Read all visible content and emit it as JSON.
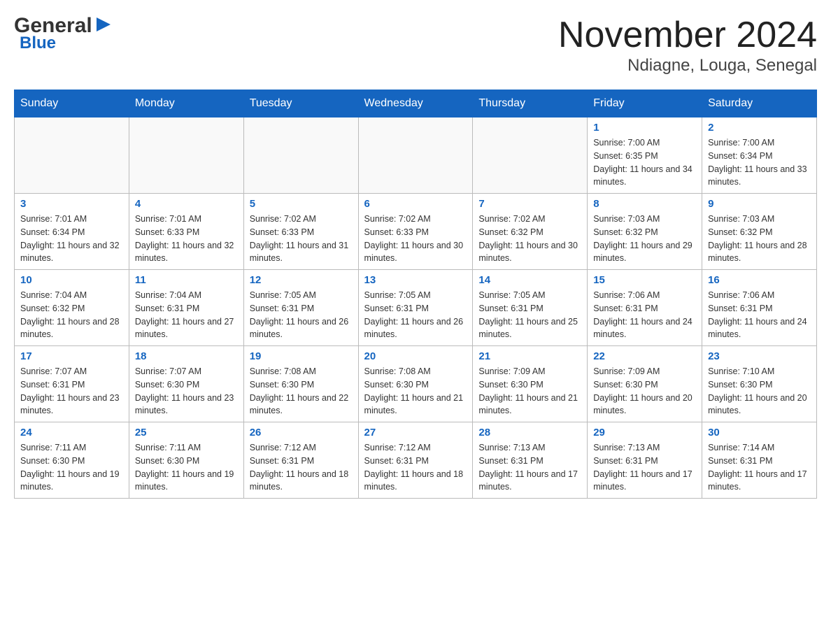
{
  "logo": {
    "general": "General",
    "arrow": "▶",
    "blue": "Blue"
  },
  "title": "November 2024",
  "subtitle": "Ndiagne, Louga, Senegal",
  "days": [
    "Sunday",
    "Monday",
    "Tuesday",
    "Wednesday",
    "Thursday",
    "Friday",
    "Saturday"
  ],
  "weeks": [
    [
      {
        "day": "",
        "info": ""
      },
      {
        "day": "",
        "info": ""
      },
      {
        "day": "",
        "info": ""
      },
      {
        "day": "",
        "info": ""
      },
      {
        "day": "",
        "info": ""
      },
      {
        "day": "1",
        "info": "Sunrise: 7:00 AM\nSunset: 6:35 PM\nDaylight: 11 hours and 34 minutes."
      },
      {
        "day": "2",
        "info": "Sunrise: 7:00 AM\nSunset: 6:34 PM\nDaylight: 11 hours and 33 minutes."
      }
    ],
    [
      {
        "day": "3",
        "info": "Sunrise: 7:01 AM\nSunset: 6:34 PM\nDaylight: 11 hours and 32 minutes."
      },
      {
        "day": "4",
        "info": "Sunrise: 7:01 AM\nSunset: 6:33 PM\nDaylight: 11 hours and 32 minutes."
      },
      {
        "day": "5",
        "info": "Sunrise: 7:02 AM\nSunset: 6:33 PM\nDaylight: 11 hours and 31 minutes."
      },
      {
        "day": "6",
        "info": "Sunrise: 7:02 AM\nSunset: 6:33 PM\nDaylight: 11 hours and 30 minutes."
      },
      {
        "day": "7",
        "info": "Sunrise: 7:02 AM\nSunset: 6:32 PM\nDaylight: 11 hours and 30 minutes."
      },
      {
        "day": "8",
        "info": "Sunrise: 7:03 AM\nSunset: 6:32 PM\nDaylight: 11 hours and 29 minutes."
      },
      {
        "day": "9",
        "info": "Sunrise: 7:03 AM\nSunset: 6:32 PM\nDaylight: 11 hours and 28 minutes."
      }
    ],
    [
      {
        "day": "10",
        "info": "Sunrise: 7:04 AM\nSunset: 6:32 PM\nDaylight: 11 hours and 28 minutes."
      },
      {
        "day": "11",
        "info": "Sunrise: 7:04 AM\nSunset: 6:31 PM\nDaylight: 11 hours and 27 minutes."
      },
      {
        "day": "12",
        "info": "Sunrise: 7:05 AM\nSunset: 6:31 PM\nDaylight: 11 hours and 26 minutes."
      },
      {
        "day": "13",
        "info": "Sunrise: 7:05 AM\nSunset: 6:31 PM\nDaylight: 11 hours and 26 minutes."
      },
      {
        "day": "14",
        "info": "Sunrise: 7:05 AM\nSunset: 6:31 PM\nDaylight: 11 hours and 25 minutes."
      },
      {
        "day": "15",
        "info": "Sunrise: 7:06 AM\nSunset: 6:31 PM\nDaylight: 11 hours and 24 minutes."
      },
      {
        "day": "16",
        "info": "Sunrise: 7:06 AM\nSunset: 6:31 PM\nDaylight: 11 hours and 24 minutes."
      }
    ],
    [
      {
        "day": "17",
        "info": "Sunrise: 7:07 AM\nSunset: 6:31 PM\nDaylight: 11 hours and 23 minutes."
      },
      {
        "day": "18",
        "info": "Sunrise: 7:07 AM\nSunset: 6:30 PM\nDaylight: 11 hours and 23 minutes."
      },
      {
        "day": "19",
        "info": "Sunrise: 7:08 AM\nSunset: 6:30 PM\nDaylight: 11 hours and 22 minutes."
      },
      {
        "day": "20",
        "info": "Sunrise: 7:08 AM\nSunset: 6:30 PM\nDaylight: 11 hours and 21 minutes."
      },
      {
        "day": "21",
        "info": "Sunrise: 7:09 AM\nSunset: 6:30 PM\nDaylight: 11 hours and 21 minutes."
      },
      {
        "day": "22",
        "info": "Sunrise: 7:09 AM\nSunset: 6:30 PM\nDaylight: 11 hours and 20 minutes."
      },
      {
        "day": "23",
        "info": "Sunrise: 7:10 AM\nSunset: 6:30 PM\nDaylight: 11 hours and 20 minutes."
      }
    ],
    [
      {
        "day": "24",
        "info": "Sunrise: 7:11 AM\nSunset: 6:30 PM\nDaylight: 11 hours and 19 minutes."
      },
      {
        "day": "25",
        "info": "Sunrise: 7:11 AM\nSunset: 6:30 PM\nDaylight: 11 hours and 19 minutes."
      },
      {
        "day": "26",
        "info": "Sunrise: 7:12 AM\nSunset: 6:31 PM\nDaylight: 11 hours and 18 minutes."
      },
      {
        "day": "27",
        "info": "Sunrise: 7:12 AM\nSunset: 6:31 PM\nDaylight: 11 hours and 18 minutes."
      },
      {
        "day": "28",
        "info": "Sunrise: 7:13 AM\nSunset: 6:31 PM\nDaylight: 11 hours and 17 minutes."
      },
      {
        "day": "29",
        "info": "Sunrise: 7:13 AM\nSunset: 6:31 PM\nDaylight: 11 hours and 17 minutes."
      },
      {
        "day": "30",
        "info": "Sunrise: 7:14 AM\nSunset: 6:31 PM\nDaylight: 11 hours and 17 minutes."
      }
    ]
  ]
}
